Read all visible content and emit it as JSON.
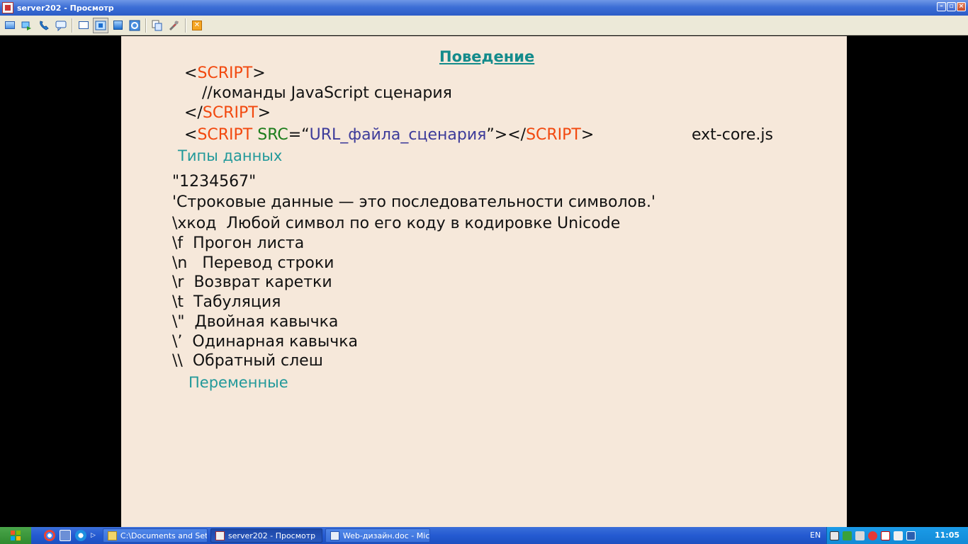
{
  "window": {
    "title": "server202 - Просмотр",
    "minimize_glyph": "–",
    "restore_glyph": "▫",
    "close_glyph": "×"
  },
  "toolbar": {
    "buttons": [
      {
        "icon": "monitor-icon"
      },
      {
        "icon": "send-keys-icon"
      },
      {
        "icon": "phone-icon"
      },
      {
        "icon": "chat-icon"
      },
      {
        "icon": "window-mode-icon"
      },
      {
        "icon": "fit-screen-icon",
        "active": true
      },
      {
        "icon": "fullscreen-icon"
      },
      {
        "icon": "refresh-icon"
      },
      {
        "icon": "copy-icon"
      },
      {
        "icon": "settings-tools-icon"
      },
      {
        "icon": "close-session-icon"
      }
    ],
    "close_glyph": "✕"
  },
  "slide": {
    "title": "Поведение",
    "code1": {
      "open": "<",
      "tag": "SCRIPT",
      "close": ">"
    },
    "code2": "//команды JavaScript сценария",
    "code3": {
      "open": "</",
      "tag": "SCRIPT",
      "close": ">"
    },
    "code4": {
      "open": "<",
      "tag": "SCRIPT",
      "sp": " ",
      "attr": "SRC",
      "eq": "=“",
      "url": "URL_файла_сценария",
      "q": "”></",
      "tag2": "SCRIPT",
      "close": ">",
      "ext": "ext-core.js"
    },
    "section_types": "Типы данных",
    "number_string": "\"1234567\"",
    "string_desc": "'Строковые данные — это последовательности символов.'",
    "escapes": [
      {
        "code": "\\xкод",
        "desc": "Любой символ по его коду в кодировке Unicode"
      },
      {
        "code": "\\f",
        "desc": "Прогон листа"
      },
      {
        "code": "\\n",
        "desc": "Перевод строки"
      },
      {
        "code": "\\r",
        "desc": "Возврат каретки"
      },
      {
        "code": "\\t",
        "desc": "Табуляция"
      },
      {
        "code": "\\\"",
        "desc": "Двойная кавычка"
      },
      {
        "code": "\\’",
        "desc": "Одинарная кавычка"
      },
      {
        "code": "\\\\",
        "desc": "Обратный слеш"
      }
    ],
    "section_vars": "Переменные"
  },
  "taskbar": {
    "tasks": [
      {
        "label": "C:\\Documents and Set..."
      },
      {
        "label": "server202 - Просмотр",
        "active": true
      },
      {
        "label": "Web-дизайн.doc - Mic..."
      }
    ],
    "lang": "EN",
    "clock": "11:05"
  },
  "colors": {
    "slide_bg": "#f6e8da",
    "tag_red": "#f2480e",
    "attr_green": "#1b7d1b",
    "url_blue": "#3d3b9a",
    "teal": "#22999a"
  }
}
